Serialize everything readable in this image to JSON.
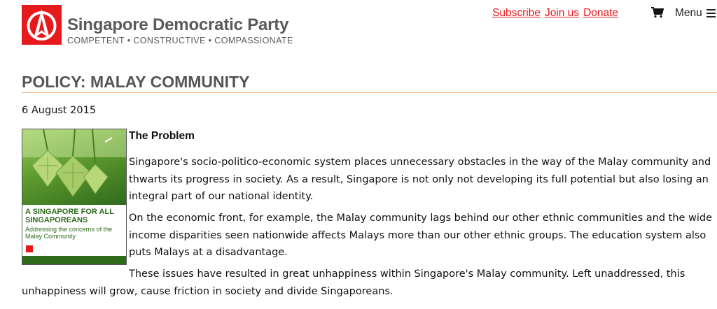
{
  "header": {
    "brand_name": "Singapore Democratic Party",
    "tagline": "COMPETENT • CONSTRUCTIVE • COMPASSIONATE",
    "links": [
      "Subscribe",
      "Join us",
      "Donate"
    ],
    "cart_icon": "shopping-cart-icon",
    "menu_label": "Menu",
    "menu_icon": "hamburger-icon",
    "logo_icon": "sdp-logo-icon",
    "brand_color": "#e6191d"
  },
  "article": {
    "title": "POLICY: MALAY COMMUNITY",
    "date": "6 August 2015",
    "cover": {
      "heading_line1": "A SINGAPORE FOR ALL",
      "heading_line2": "SINGAPOREANS",
      "subtitle_line1": "Addressing the concerns of the",
      "subtitle_line2": "Malay Community"
    },
    "section_heading": "The Problem",
    "paragraphs": [
      "Singapore's socio-politico-economic system places unnecessary obstacles in the way of the Malay community and thwarts its progress in society. As a result, Singapore is not only not developing its full potential but also losing an integral part of our national identity.",
      "On the economic front, for example, the Malay community lags behind our other ethnic communities and the wide income disparities seen nationwide affects Malays more than our other ethnic groups. The education system also puts Malays at a disadvantage.",
      "These issues have resulted in great unhappiness within Singapore's Malay community. Left unaddressed, this unhappiness will grow, cause friction in society and divide Singaporeans."
    ]
  }
}
